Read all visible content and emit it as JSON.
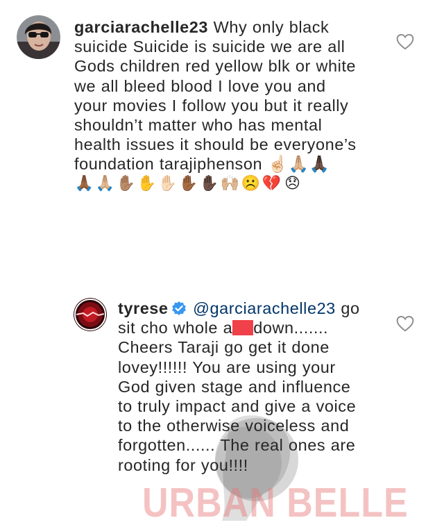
{
  "comments": [
    {
      "username": "garciarachelle23",
      "lines": [
        " Why only black",
        "suicide  Suicide is suicide we are all",
        "Gods children red yellow blk or white",
        "we all bleed blood I love you and",
        "your movies I follow you but it really",
        "shouldn’t matter who has mental",
        "health issues it should be everyone’s",
        "foundation  tarajiphenson"
      ],
      "emoji_line_1": [
        "☝🏻",
        "🙏🏼",
        "🙏🏿"
      ],
      "emoji_line_2": [
        "🙏🏾",
        "🙏🏼",
        "✋🏽",
        "✋",
        "✋🏻",
        "✋🏾",
        "✋🏿",
        "🙌🏼",
        "☹️",
        "💔",
        "😞"
      ],
      "like_icon": "heart-outline-icon"
    },
    {
      "username": "tyrese",
      "verified_icon": "verified-badge-icon",
      "mention": "@garciarachelle23",
      "first_line_tail": " go",
      "second_line_pre": "sit cho whole a",
      "second_line_post": "down.......",
      "lines": [
        "Cheers Taraji go get it done",
        "lovey!!!!!! You are using your",
        "God given stage and influence",
        "to truly impact and give a voice",
        "to the otherwise voiceless and",
        "forgotten...... The real ones are",
        "rooting for you!!!!"
      ],
      "like_icon": "heart-outline-icon"
    }
  ],
  "watermark": {
    "text": "URBAN BELLE"
  },
  "colors": {
    "text": "#262626",
    "heart": "#8e8e8e",
    "verified": "#3897f0",
    "redaction": "#f0404a"
  }
}
